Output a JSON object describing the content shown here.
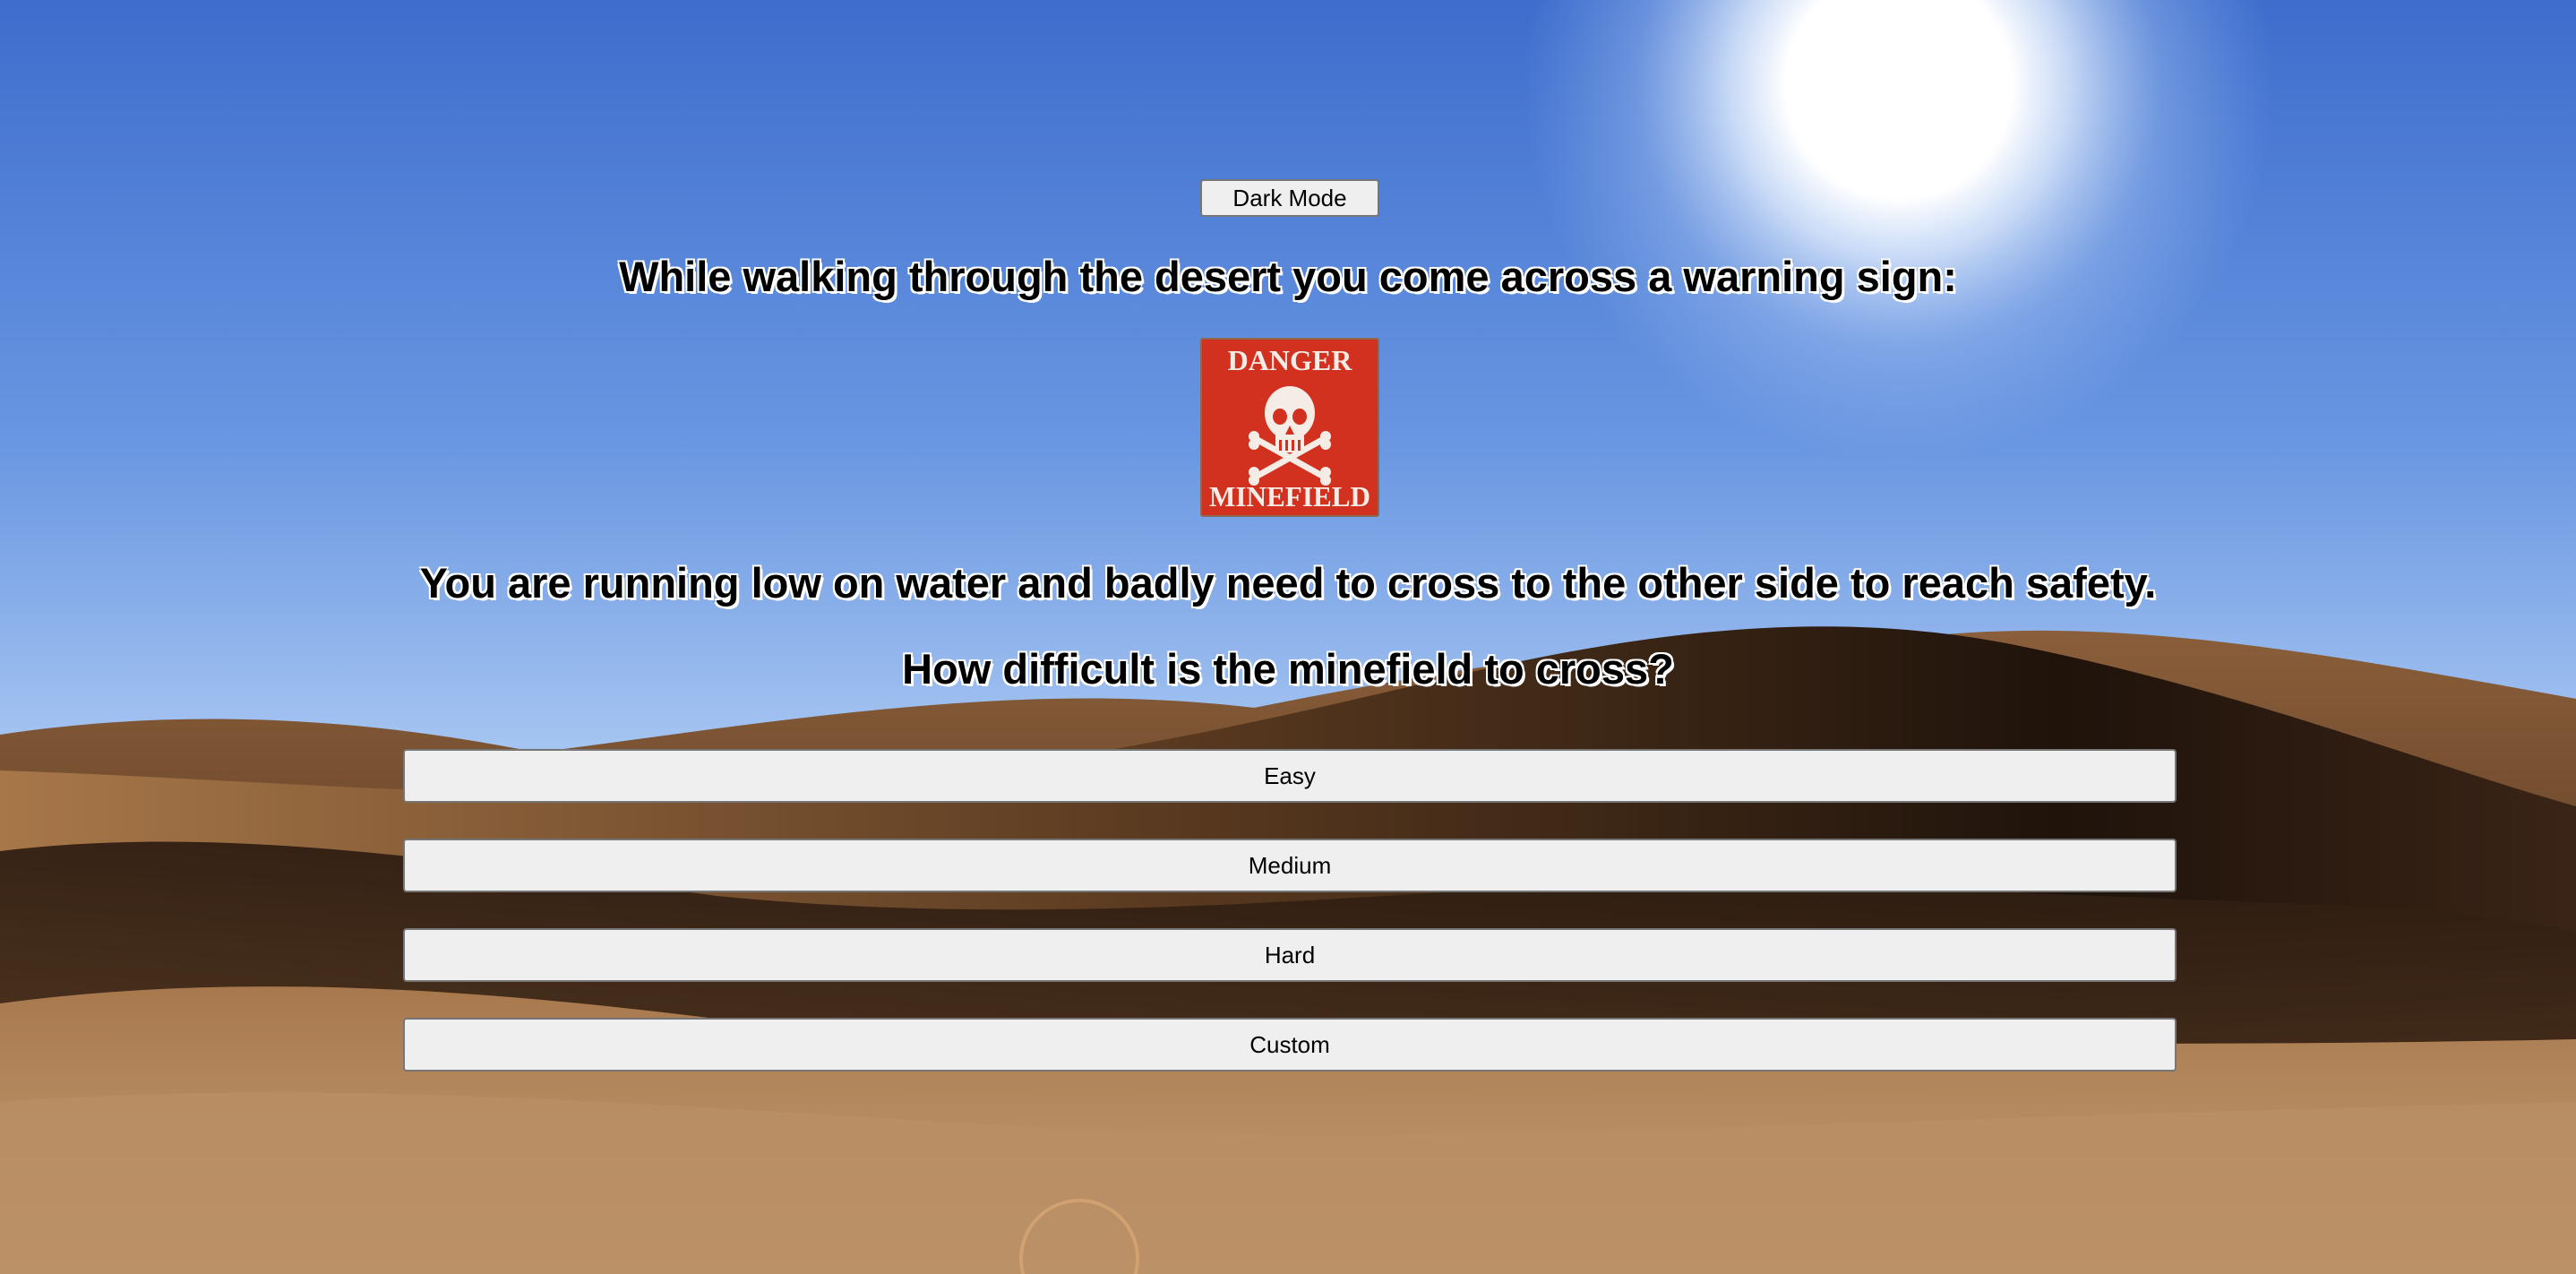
{
  "toggle": {
    "dark_mode_label": "Dark Mode"
  },
  "story": {
    "intro": "While walking through the desert you come across a warning sign:",
    "situation": "You are running low on water and badly need to cross to the other side to reach safety.",
    "question": "How difficult is the minefield to cross?"
  },
  "sign": {
    "top_text": "DANGER",
    "bottom_text": "MINEFIELD",
    "icon": "skull-crossbones-icon",
    "color": "#d2311f"
  },
  "difficulty": {
    "options": [
      {
        "label": "Easy"
      },
      {
        "label": "Medium"
      },
      {
        "label": "Hard"
      },
      {
        "label": "Custom"
      }
    ]
  },
  "colors": {
    "sky_top": "#3e6fce",
    "sky_horizon": "#a9c8f2",
    "sand_light": "#b88f63",
    "sand_dark": "#2a1a10"
  }
}
